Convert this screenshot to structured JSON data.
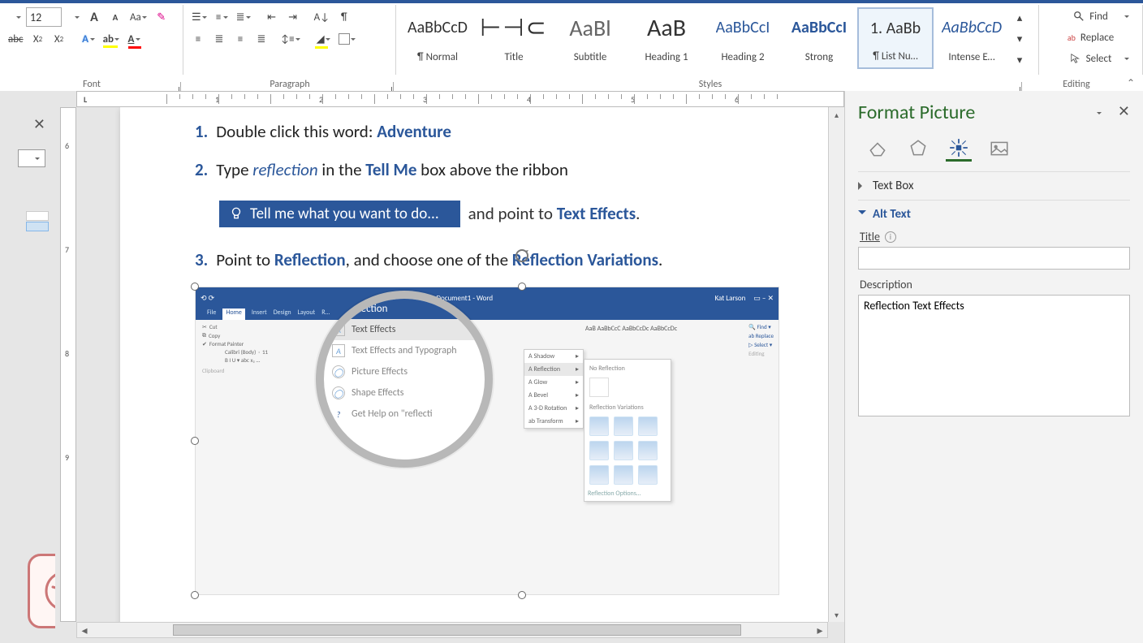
{
  "ribbon": {
    "font_size": "12",
    "groups": {
      "font": "Font",
      "paragraph": "Paragraph",
      "styles": "Styles",
      "editing": "Editing"
    },
    "styles_gallery": [
      {
        "preview": "AaBbCcD",
        "name": "¶ Normal",
        "preview_style": "font-size:20px;color:#333"
      },
      {
        "preview": "⊢⊣⊂",
        "name": "Title",
        "preview_style": "font-size:30px;color:#333;letter-spacing:2px"
      },
      {
        "preview": "AaBl",
        "name": "Subtitle",
        "preview_style": "font-size:28px;color:#666"
      },
      {
        "preview": "AaB",
        "name": "Heading 1",
        "preview_style": "font-size:30px;color:#333"
      },
      {
        "preview": "AaBbCcI",
        "name": "Heading 2",
        "preview_style": "font-size:20px;color:#2b579a"
      },
      {
        "preview": "AaBbCcI",
        "name": "Strong",
        "preview_style": "font-size:20px;color:#2b579a;font-weight:bold"
      },
      {
        "preview": "1. AaBb",
        "name": "¶ List Nu…",
        "preview_style": "font-size:20px;color:#333",
        "selected": true
      },
      {
        "preview": "AaBbCcD",
        "name": "Intense E…",
        "preview_style": "font-size:20px;color:#2b579a;font-style:italic"
      }
    ],
    "editing": {
      "find": "Find",
      "replace": "Replace",
      "select": "Select"
    }
  },
  "ruler": {
    "h_numbers": [
      "1",
      "2",
      "3",
      "4",
      "5",
      "6"
    ],
    "v_numbers": [
      "6",
      "7",
      "8",
      "9"
    ]
  },
  "document": {
    "items": [
      {
        "n": "1.",
        "pre": "Double click this word: ",
        "bold": "Adventure",
        "post": ""
      },
      {
        "n": "2.",
        "pre": "Type ",
        "italic": "reflection",
        "mid": " in the ",
        "bold": "Tell Me",
        "post": " box above the ribbon"
      },
      {
        "n": "3.",
        "pre": "Point to ",
        "bold1": "Reflection",
        "mid": ", and choose one of the ",
        "bold2": "Reflection Variations",
        "post": "."
      }
    ],
    "tellme_placeholder": "Tell me what you want to do...",
    "after_chip_pre": "and point to ",
    "after_chip_bold": "Text Effects",
    "after_chip_post": "."
  },
  "embedded": {
    "doc_title": "Document1 - Word",
    "user": "Kat Larson",
    "tabs": [
      "File",
      "Home",
      "Insert",
      "Design",
      "Layout",
      "R…"
    ],
    "search_value": "reflection",
    "menu": [
      "Text Effects",
      "Text Effects and Typograph",
      "Picture Effects",
      "Shape Effects",
      "Get Help on \"reflecti"
    ],
    "flyout": [
      "Shadow",
      "Reflection",
      "Glow",
      "Bevel",
      "3-D Rotation",
      "Transform"
    ],
    "flyout2_top": "No Reflection",
    "flyout2_hdr": "Reflection Variations",
    "flyout2_opt": "Reflection Options…",
    "mini_style_row": "AaB  AaBbCcC  AaBbCcDc  AaBbCcDc",
    "right": {
      "find": "Find ▾",
      "replace": "Replace",
      "select": "Select ▾",
      "grp": "Editing"
    },
    "clipboard": {
      "cut": "Cut",
      "copy": "Copy",
      "fp": "Format Painter",
      "grp": "Clipboard",
      "font": "Calibri (Body)",
      "size": "11",
      "biu": "B  I  U ▾ abc  x₂  …"
    }
  },
  "format_picture": {
    "title": "Format Picture",
    "sections": {
      "textbox": "Text Box",
      "alttext": "Alt Text"
    },
    "title_label": "Title",
    "title_value": "",
    "desc_label": "Description",
    "desc_value": "Reflection Text Effects"
  }
}
